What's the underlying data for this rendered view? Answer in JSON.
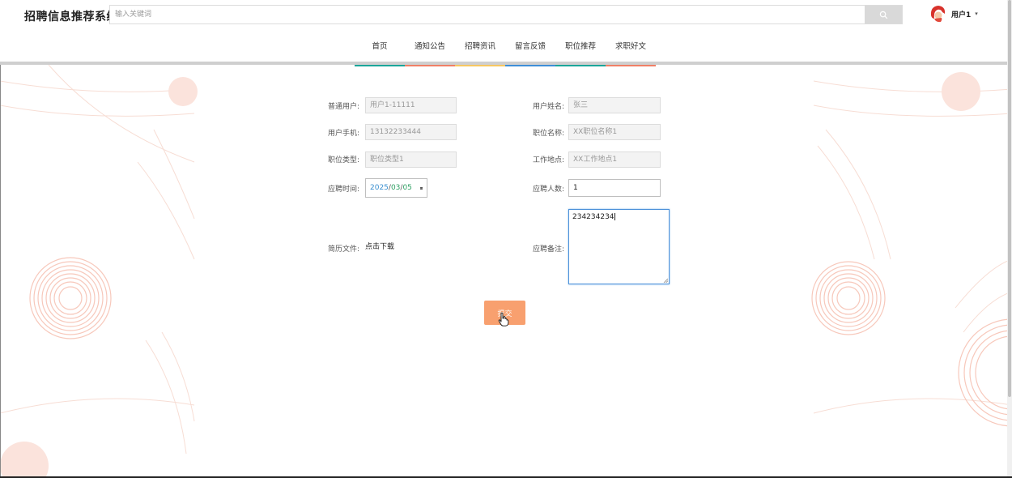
{
  "header": {
    "title": "招聘信息推荐系统",
    "search_placeholder": "输入关键词",
    "user_name": "用户1",
    "user_caret": "▾"
  },
  "nav": {
    "items": [
      {
        "label": "首页",
        "color": "#1aa69a"
      },
      {
        "label": "通知公告",
        "color": "#f07f66"
      },
      {
        "label": "招聘资讯",
        "color": "#f6c761"
      },
      {
        "label": "留言反馈",
        "color": "#3d8ed8"
      },
      {
        "label": "职位推荐",
        "color": "#1aa69a"
      },
      {
        "label": "求职好文",
        "color": "#f07f66"
      }
    ]
  },
  "form": {
    "normal_user_label": "普通用户:",
    "normal_user_value": "用户1-11111",
    "user_name_label": "用户姓名:",
    "user_name_value": "张三",
    "phone_label": "用户手机:",
    "phone_value": "13132233444",
    "position_name_label": "职位名称:",
    "position_name_value": "XX职位名称1",
    "position_type_label": "职位类型:",
    "position_type_value": "职位类型1",
    "work_location_label": "工作地点:",
    "work_location_value": "XX工作地点1",
    "apply_time_label": "应聘时间:",
    "apply_date_year": "2025",
    "apply_date_month": "03",
    "apply_date_day": "05",
    "date_separator": "/",
    "applicants_label": "应聘人数:",
    "applicants_value": "1",
    "resume_label": "简历文件:",
    "resume_link": "点击下载",
    "remark_label": "应聘备注:",
    "remark_value": "234234234",
    "submit_label": "提交"
  },
  "colors": {
    "submit": "#f8a06f",
    "decoration": "#f7d6cc"
  }
}
